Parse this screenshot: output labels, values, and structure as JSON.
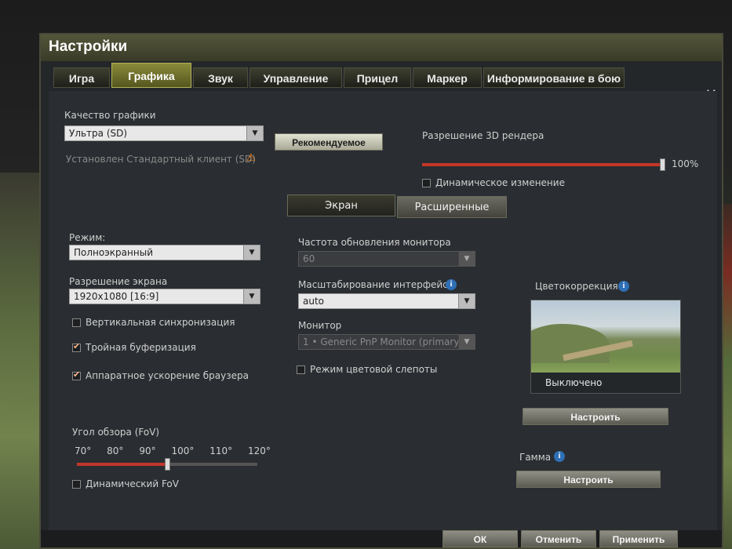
{
  "window": {
    "title": "Настройки"
  },
  "tabs": [
    {
      "label": "Игра"
    },
    {
      "label": "Графика",
      "active": true
    },
    {
      "label": "Звук"
    },
    {
      "label": "Управление"
    },
    {
      "label": "Прицел"
    },
    {
      "label": "Маркер"
    },
    {
      "label": "Информирование в бою"
    }
  ],
  "quality": {
    "label": "Качество графики",
    "value": "Ультра (SD)",
    "client_note": "Установлен Стандартный клиент (SD)",
    "recommended_button": "Рекомендуемое"
  },
  "render": {
    "label": "Разрешение 3D рендера",
    "value_text": "100%",
    "level": 1.0,
    "dynamic_label": "Динамическое изменение",
    "dynamic_checked": false
  },
  "subtabs": [
    {
      "label": "Экран",
      "active": true
    },
    {
      "label": "Расширенные"
    }
  ],
  "screen": {
    "mode_label": "Режим:",
    "mode_value": "Полноэкранный",
    "resolution_label": "Разрешение экрана",
    "resolution_value": "1920x1080 [16:9]",
    "vsync_label": "Вертикальная синхронизация",
    "vsync_checked": false,
    "triple_label": "Тройная буферизация",
    "triple_checked": true,
    "hw_accel_label": "Аппаратное ускорение браузера",
    "hw_accel_checked": true,
    "fov_label": "Угол обзора (FoV)",
    "fov_ticks": [
      "70°",
      "80°",
      "90°",
      "100°",
      "110°",
      "120°"
    ],
    "fov_value": 95,
    "fov_range": [
      70,
      120
    ],
    "dynamic_fov_label": "Динамический FoV",
    "dynamic_fov_checked": false
  },
  "monitor": {
    "refresh_label": "Частота обновления монитора",
    "refresh_value": "60",
    "scale_label": "Масштабирование интерфейса",
    "scale_value": "auto",
    "monitor_label": "Монитор",
    "monitor_value": "1 • Generic PnP Monitor (primary)",
    "colorblind_label": "Режим цветовой слепоты",
    "colorblind_checked": false
  },
  "color": {
    "label": "Цветокоррекция",
    "status": "Выключено",
    "configure_button": "Настроить"
  },
  "gamma": {
    "label": "Гамма",
    "configure_button": "Настроить"
  },
  "footer": {
    "ok": "ОК",
    "cancel": "Отменить",
    "apply": "Применить"
  },
  "colors": {
    "slider_accent": "#c4362a",
    "active_tab": "#8a8a3a",
    "info_icon": "#2f6fb5",
    "warning": "#ff8a1a"
  }
}
